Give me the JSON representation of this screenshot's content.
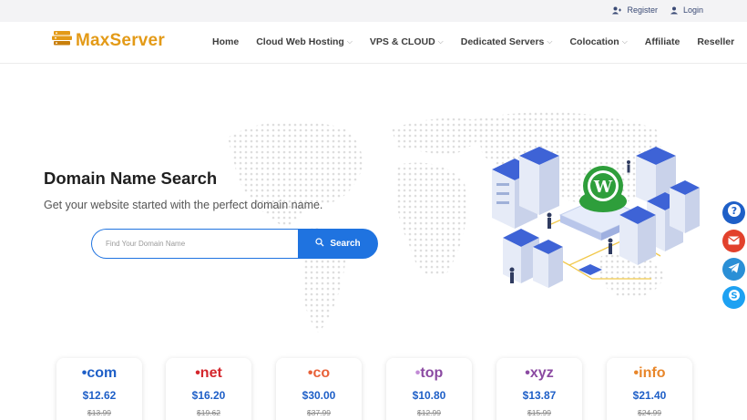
{
  "topbar": {
    "register": "Register",
    "login": "Login"
  },
  "brand": {
    "name": "MaxServer",
    "color": "#e39a17"
  },
  "nav": [
    {
      "label": "Home",
      "dropdown": false
    },
    {
      "label": "Cloud Web Hosting",
      "dropdown": true
    },
    {
      "label": "VPS & CLOUD",
      "dropdown": true
    },
    {
      "label": "Dedicated Servers",
      "dropdown": true
    },
    {
      "label": "Colocation",
      "dropdown": true
    },
    {
      "label": "Affiliate",
      "dropdown": false
    },
    {
      "label": "Reseller",
      "dropdown": false
    }
  ],
  "hero": {
    "title": "Domain Name Search",
    "subtitle": "Get your website started with the perfect domain name.",
    "search_placeholder": "Find Your Domain Name",
    "search_button": "Search",
    "accent": "#1f73e0"
  },
  "side_buttons": [
    {
      "icon": "help-icon",
      "color": "#1e5fc7"
    },
    {
      "icon": "email-icon",
      "color": "#e2412c"
    },
    {
      "icon": "telegram-icon",
      "color": "#2a8fd6"
    },
    {
      "icon": "skype-icon",
      "color": "#1da1f2"
    }
  ],
  "domains": [
    {
      "tld": "com",
      "price": "$12.62",
      "old_price": "$13.99",
      "color": "#1e5fc7"
    },
    {
      "tld": "net",
      "price": "$16.20",
      "old_price": "$19.62",
      "color": "#d4262c"
    },
    {
      "tld": "co",
      "price": "$30.00",
      "old_price": "$37.99",
      "color": "#e8623a"
    },
    {
      "tld": "top",
      "price": "$10.80",
      "old_price": "$12.99",
      "color": "#8b4aa2"
    },
    {
      "tld": "xyz",
      "price": "$13.87",
      "old_price": "$15.99",
      "color": "#8b4aa2"
    },
    {
      "tld": "info",
      "price": "$21.40",
      "old_price": "$24.99",
      "color": "#e8862a"
    }
  ]
}
